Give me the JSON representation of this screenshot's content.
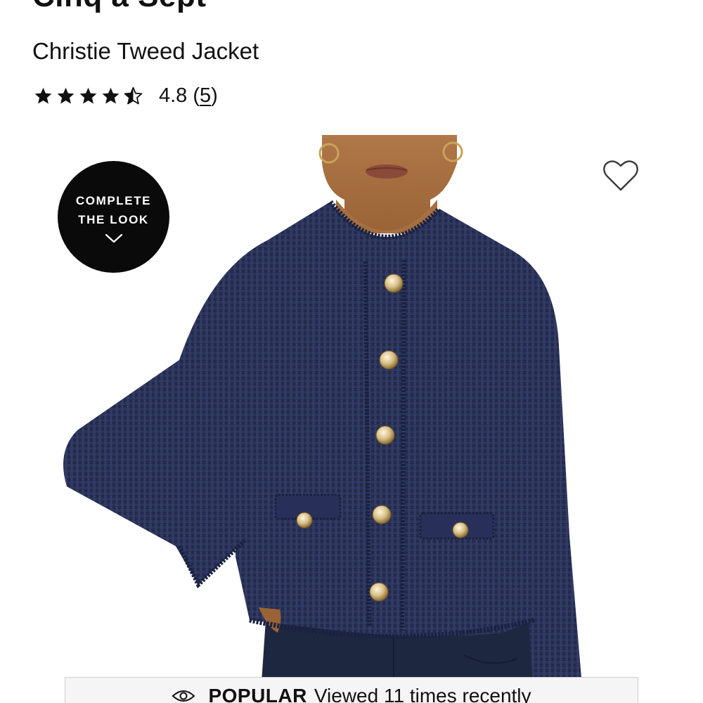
{
  "product": {
    "brand": "Cinq à Sept",
    "name": "Christie Tweed Jacket",
    "rating": {
      "value_text": "4.8",
      "open_paren": "(",
      "count_text": "5",
      "close_paren": ")",
      "stars_value": 4.5,
      "stars_max": 5
    }
  },
  "hero": {
    "image_alt": "Christie Tweed Jacket",
    "complete_the_look": {
      "line1": "COMPLETE",
      "line2": "THE LOOK",
      "icon": "chevron-down-icon"
    },
    "wishlist_icon": "heart-outline-icon"
  },
  "popular": {
    "icon": "eye-icon",
    "label": "POPULAR",
    "text": "Viewed 11 times recently"
  },
  "colors": {
    "jacket_navy": "#2a3358",
    "badge_black": "#0a0a0a",
    "button_gold": "#d8c08a",
    "skin": "#a8703f",
    "popular_bg": "#f5f5f5"
  }
}
